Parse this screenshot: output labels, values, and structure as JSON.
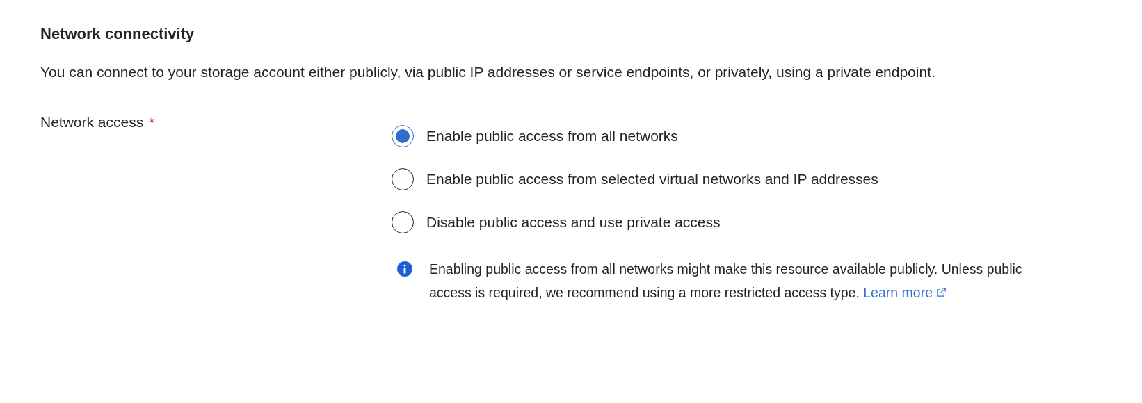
{
  "section": {
    "title": "Network connectivity",
    "description": "You can connect to your storage account either publicly, via public IP addresses or service endpoints, or privately, using a private endpoint."
  },
  "field": {
    "label": "Network access",
    "required_mark": "*"
  },
  "options": [
    {
      "label": "Enable public access from all networks",
      "selected": true
    },
    {
      "label": "Enable public access from selected virtual networks and IP addresses",
      "selected": false
    },
    {
      "label": "Disable public access and use private access",
      "selected": false
    }
  ],
  "info": {
    "text": "Enabling public access from all networks might make this resource available publicly. Unless public access is required, we recommend using a more restricted access type.",
    "link": "Learn more"
  }
}
